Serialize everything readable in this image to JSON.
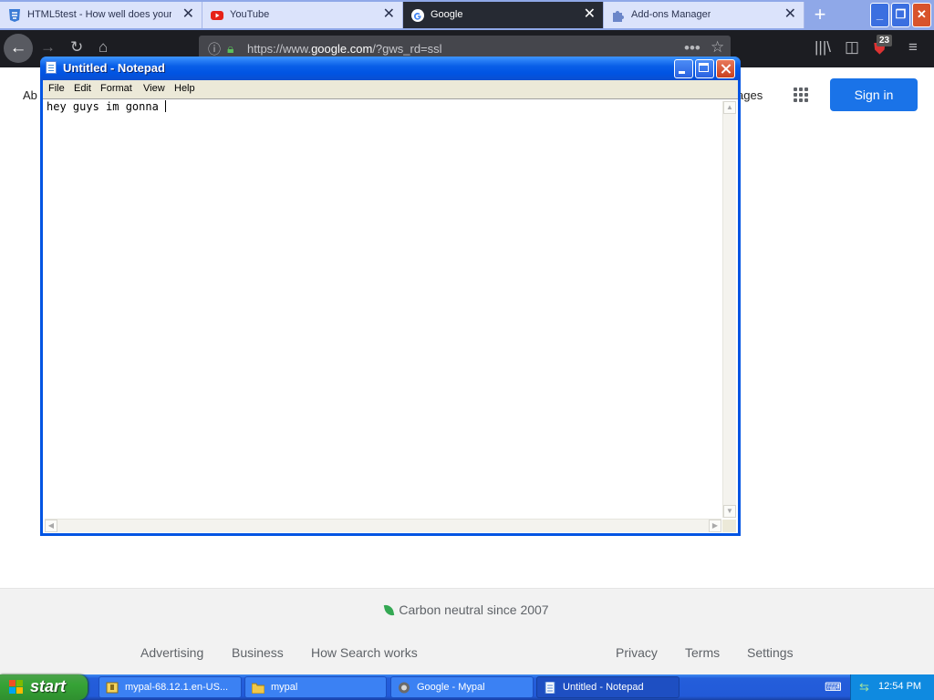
{
  "browser": {
    "tabs": [
      {
        "label": "HTML5test - How well does your"
      },
      {
        "label": "YouTube"
      },
      {
        "label": "Google"
      },
      {
        "label": "Add-ons Manager"
      }
    ],
    "url": {
      "prefix": "https://www.",
      "domain": "google.com",
      "path": "/?gws_rd=ssl"
    },
    "badge_count": "23"
  },
  "google": {
    "about_label": "Ab",
    "images_label": "ages",
    "sign_in_label": "Sign in",
    "carbon_text": "Carbon neutral since 2007",
    "footer_left": [
      "Advertising",
      "Business",
      "How Search works"
    ],
    "footer_right": [
      "Privacy",
      "Terms",
      "Settings"
    ]
  },
  "notepad": {
    "title": "Untitled - Notepad",
    "menu": [
      "File",
      "Edit",
      "Format",
      "View",
      "Help"
    ],
    "text": "hey guys im gonna "
  },
  "taskbar": {
    "start_label": "start",
    "tasks": [
      {
        "label": "mypal-68.12.1.en-US..."
      },
      {
        "label": "mypal"
      },
      {
        "label": "Google - Mypal"
      },
      {
        "label": "Untitled - Notepad"
      }
    ],
    "clock": "12:54 PM"
  }
}
